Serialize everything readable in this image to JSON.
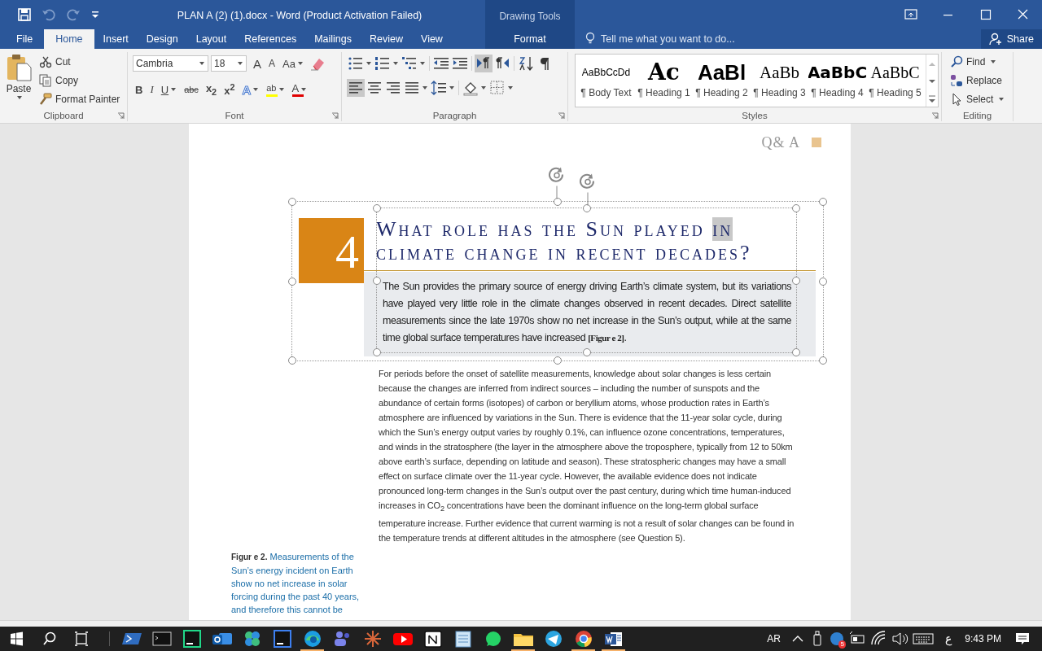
{
  "window": {
    "title": "PLAN A (2) (1).docx - Word (Product Activation Failed)",
    "context_label": "Drawing Tools"
  },
  "quick_access": [
    {
      "kind": "save",
      "disabled": false
    },
    {
      "kind": "undo",
      "disabled": true
    },
    {
      "kind": "redo",
      "disabled": true
    },
    {
      "kind": "customize",
      "disabled": false
    }
  ],
  "tabs": [
    {
      "label": "File",
      "selected": false,
      "kind": "normal"
    },
    {
      "label": "Home",
      "selected": true,
      "kind": "normal"
    },
    {
      "label": "Insert",
      "selected": false,
      "kind": "normal"
    },
    {
      "label": "Design",
      "selected": false,
      "kind": "normal"
    },
    {
      "label": "Layout",
      "selected": false,
      "kind": "normal"
    },
    {
      "label": "References",
      "selected": false,
      "kind": "normal"
    },
    {
      "label": "Mailings",
      "selected": false,
      "kind": "normal"
    },
    {
      "label": "Review",
      "selected": false,
      "kind": "normal"
    },
    {
      "label": "View",
      "selected": false,
      "kind": "normal"
    },
    {
      "label": "Format",
      "selected": false,
      "kind": "contextual"
    }
  ],
  "tell_me": {
    "placeholder": "Tell me what you want to do..."
  },
  "share": {
    "label": "Share"
  },
  "clipboard": {
    "label": "Clipboard",
    "paste": "Paste",
    "commands": [
      {
        "kind": "cut",
        "label": "Cut"
      },
      {
        "kind": "copy",
        "label": "Copy"
      },
      {
        "kind": "painter",
        "label": "Format Painter"
      }
    ]
  },
  "font": {
    "label": "Font",
    "family": "Cambria",
    "size": "18",
    "top_tools": [
      {
        "kind": "grow",
        "text": "A"
      },
      {
        "kind": "shrink",
        "text": "A"
      },
      {
        "kind": "case",
        "text": "Aa"
      },
      {
        "kind": "clear"
      }
    ],
    "bottom_tools": [
      {
        "kind": "bold",
        "text": "B"
      },
      {
        "kind": "italic",
        "text": "I"
      },
      {
        "kind": "underline",
        "text": "U"
      },
      {
        "kind": "strike",
        "text": "abc"
      },
      {
        "kind": "sub",
        "text": "x$_{2}$"
      },
      {
        "kind": "sup",
        "text": "x$^{2}$"
      },
      {
        "kind": "effects",
        "text": "A"
      },
      {
        "kind": "highlight",
        "text": "ab"
      },
      {
        "kind": "color",
        "text": "A"
      }
    ]
  },
  "paragraph": {
    "label": "Paragraph",
    "top_tools": [
      {
        "kind": "bullets",
        "selected": false
      },
      {
        "kind": "numbering",
        "selected": false
      },
      {
        "kind": "multilevel",
        "selected": false
      },
      {
        "kind": "outdent",
        "selected": false
      },
      {
        "kind": "indent",
        "selected": false
      },
      {
        "kind": "ltr",
        "selected": true
      },
      {
        "kind": "rtl",
        "selected": false
      },
      {
        "kind": "sort",
        "selected": false
      },
      {
        "kind": "marks",
        "selected": false
      }
    ],
    "bottom_tools": [
      {
        "kind": "left",
        "selected": true
      },
      {
        "kind": "center",
        "selected": false
      },
      {
        "kind": "right",
        "selected": false
      },
      {
        "kind": "justify",
        "selected": false
      },
      {
        "kind": "spacing",
        "selected": false
      },
      {
        "kind": "shading",
        "selected": false
      },
      {
        "kind": "borders",
        "selected": false
      }
    ]
  },
  "styles": {
    "label": "Styles",
    "items": [
      {
        "kind": "body",
        "preview": "AaBbCcDd",
        "name": "¶ Body Text"
      },
      {
        "kind": "h1",
        "preview": "Ac",
        "name": "¶ Heading 1"
      },
      {
        "kind": "h2",
        "preview": "AaBl",
        "name": "¶ Heading 2"
      },
      {
        "kind": "h3",
        "preview": "AaBb",
        "name": "¶ Heading 3"
      },
      {
        "kind": "h4",
        "preview": "AaBbC",
        "name": "¶ Heading 4"
      },
      {
        "kind": "h5",
        "preview": "AaBbC",
        "name": "¶ Heading 5"
      }
    ]
  },
  "editing": {
    "label": "Editing",
    "commands": [
      {
        "kind": "find",
        "label": "Find"
      },
      {
        "kind": "replace",
        "label": "Replace"
      },
      {
        "kind": "select",
        "label": "Select"
      }
    ]
  },
  "document": {
    "header_label": "Q& A",
    "number": "4",
    "heading": [
      {
        "text": "What role has the Sun played ",
        "selected": false
      },
      {
        "text": "in",
        "selected": true
      },
      {
        "text": " climate change in recent decades?",
        "selected": false
      }
    ],
    "summary": "The Sun provides the primary source of energy driving Earth’s climate system, but its variations have played very little role in the climate changes observed in recent decades. Direct satellite measurements since the late 1970s show no net increase in the Sun’s output, while at the same time global surface temperatures have increased **[Figur e 2]**.",
    "body": "For periods before the onset of satellite measurements, knowledge about solar changes is less certain because the changes are inferred from indirect sources – including the number of sunspots and the abundance of certain forms (isotopes) of carbon or beryllium atoms, whose production rates in Earth’s atmosphere are influenced by variations in the Sun. There is evidence that the 11-year solar cycle, during which the Sun’s energy output varies by roughly 0.1%, can influence ozone concentrations, temperatures, and winds in the stratosphere (the layer in the atmosphere above the troposphere, typically from 12 to 50km above earth’s surface, depending on latitude and season). These stratospheric changes may have a small effect on surface climate over the 11-year cycle. However, the available evidence does not indicate pronounced long-term changes in the Sun’s output over the past century, during which time human-induced increases in CO$_{2}$ concentrations have been the dominant influence on the long-term global surface temperature increase. Further evidence that current warming is not a result of solar changes can be found in the temperature trends at different altitudes in the atmosphere (see Question 5).",
    "caption": "**Figur e 2.** Measurements of the Sun’s energy incident on Earth show no net increase in solar forcing during the past 40 years, and therefore this cannot be"
  },
  "taskbar": {
    "apps": [
      {
        "kind": "powershell",
        "running": false
      },
      {
        "kind": "cmd",
        "running": false
      },
      {
        "kind": "pycharm",
        "running": false
      },
      {
        "kind": "outlook",
        "running": false
      },
      {
        "kind": "greenapp",
        "running": false
      },
      {
        "kind": "intellij",
        "running": false
      },
      {
        "kind": "edge",
        "running": true
      },
      {
        "kind": "teams",
        "running": false
      },
      {
        "kind": "spark",
        "running": false
      },
      {
        "kind": "youtube",
        "running": false
      },
      {
        "kind": "notion",
        "running": false
      },
      {
        "kind": "notepad",
        "running": false
      },
      {
        "kind": "whatsapp",
        "running": false
      },
      {
        "kind": "folder",
        "running": true
      },
      {
        "kind": "telegram",
        "running": false
      },
      {
        "kind": "chrome",
        "running": true
      },
      {
        "kind": "word",
        "running": true
      }
    ],
    "language": "AR",
    "tray_badge": "5",
    "input_method": "ع",
    "time": "9:43 PM"
  }
}
